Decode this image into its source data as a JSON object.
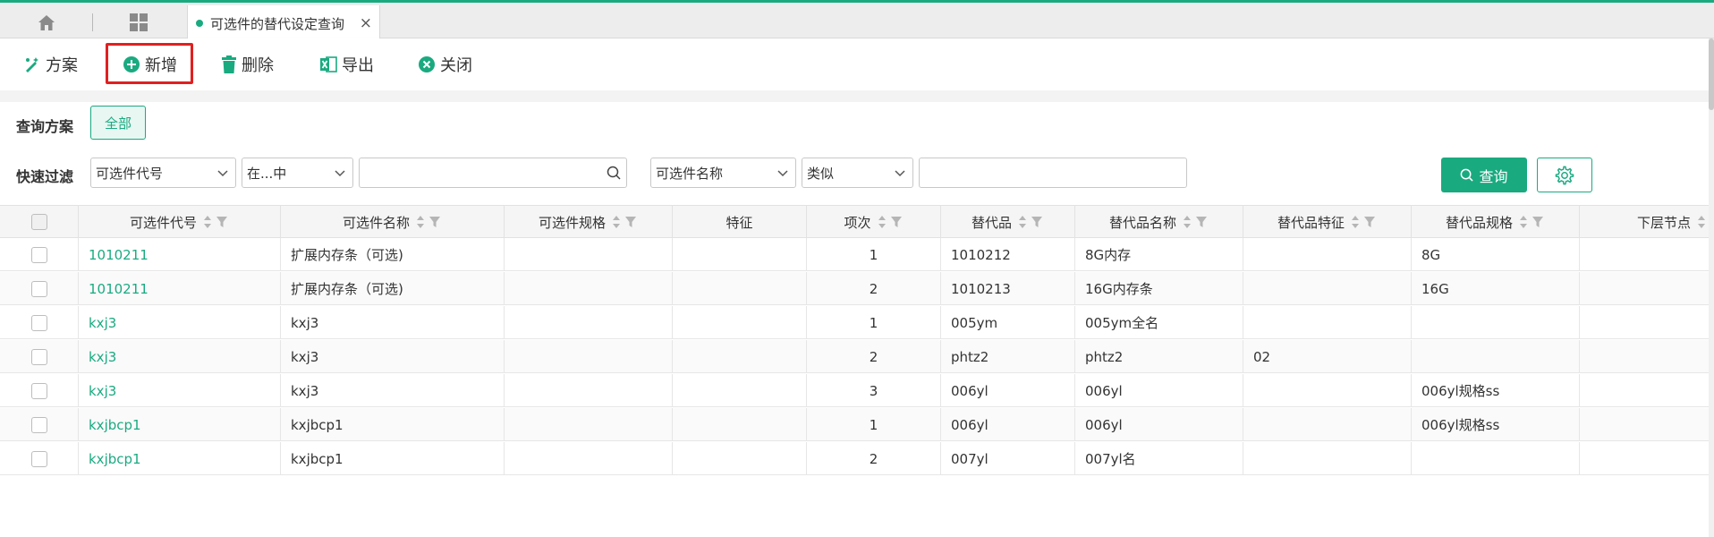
{
  "tabbar": {
    "home_icon": "home-icon",
    "grid_icon": "grid-icon",
    "active_tab": {
      "label": "可选件的替代设定查询",
      "close": "×"
    }
  },
  "toolbar": {
    "buttons": [
      {
        "label": "方案",
        "icon": "scheme-icon"
      },
      {
        "label": "新增",
        "icon": "plus-circle-icon"
      },
      {
        "label": "删除",
        "icon": "trash-icon"
      },
      {
        "label": "导出",
        "icon": "excel-icon"
      },
      {
        "label": "关闭",
        "icon": "close-circle-icon"
      }
    ]
  },
  "query_scheme": {
    "label": "查询方案",
    "options": [
      "全部"
    ]
  },
  "quick_filter": {
    "label": "快速过滤",
    "field1": "可选件代号",
    "op1": "在...中",
    "value1": "",
    "field2": "可选件名称",
    "op2": "类似",
    "value2": "",
    "query_label": "查询"
  },
  "colors": {
    "accent": "#1aaa80",
    "highlight": "#e02020"
  },
  "table": {
    "columns": [
      "可选件代号",
      "可选件名称",
      "可选件规格",
      "特征",
      "项次",
      "替代品",
      "替代品名称",
      "替代品特征",
      "替代品规格",
      "下层节点"
    ],
    "rows": [
      [
        "1010211",
        "扩展内存条（可选)",
        "",
        "",
        "1",
        "1010212",
        "8G内存",
        "",
        "8G",
        ""
      ],
      [
        "1010211",
        "扩展内存条（可选)",
        "",
        "",
        "2",
        "1010213",
        "16G内存条",
        "",
        "16G",
        ""
      ],
      [
        "kxj3",
        "kxj3",
        "",
        "",
        "1",
        "005ym",
        "005ym全名",
        "",
        "",
        ""
      ],
      [
        "kxj3",
        "kxj3",
        "",
        "",
        "2",
        "phtz2",
        "phtz2",
        "02",
        "",
        ""
      ],
      [
        "kxj3",
        "kxj3",
        "",
        "",
        "3",
        "006yl",
        "006yl",
        "",
        "006yl规格ss",
        ""
      ],
      [
        "kxjbcp1",
        "kxjbcp1",
        "",
        "",
        "1",
        "006yl",
        "006yl",
        "",
        "006yl规格ss",
        ""
      ],
      [
        "kxjbcp1",
        "kxjbcp1",
        "",
        "",
        "2",
        "007yl",
        "007yl名",
        "",
        "",
        ""
      ]
    ]
  }
}
